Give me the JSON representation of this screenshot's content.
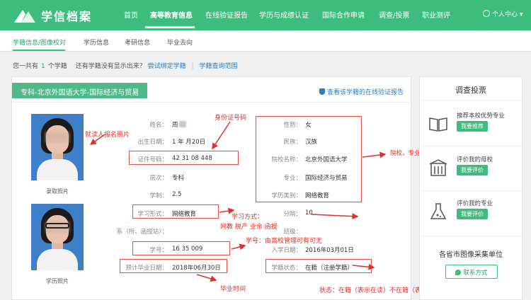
{
  "brand": {
    "name": "学信档案"
  },
  "nav": {
    "items": [
      "首页",
      "高等教育信息",
      "在线验证报告",
      "学历与成绩认证",
      "国际合作申请",
      "调查/投票",
      "职业测评"
    ],
    "user": "个人中心 ▾"
  },
  "subnav": {
    "items": [
      "学籍信息/图像校对",
      "学历信息",
      "考研信息",
      "毕业去向"
    ]
  },
  "summary": {
    "prefix": "您一共有",
    "count": "1",
    "suffix": "个学籍",
    "question": "还有学籍没有显示出来？",
    "bind_link": "尝试绑定学籍",
    "sep": "|",
    "scope_link": "学籍查询范围"
  },
  "card": {
    "title": "专科-北京外国语大学-国际经济与贸易",
    "verify_link": "查看该学籍的在线验证报告",
    "photo_captions": [
      "录取照片",
      "学历照片"
    ],
    "left_fields": [
      {
        "label": "姓名：",
        "value": "周"
      },
      {
        "label": "出生日期：",
        "value": "1 年 月20日"
      },
      {
        "label": "证件号码：",
        "value": "42 31 08 448"
      },
      {
        "label": "层次：",
        "value": "专科"
      },
      {
        "label": "学制：",
        "value": "2.5"
      },
      {
        "label": "学习形式：",
        "value": "网络教育"
      },
      {
        "label": "系（所、函授站）：",
        "value": ""
      },
      {
        "label": "学号：",
        "value": "16 35 009"
      },
      {
        "label": "预计毕业日期：",
        "value": "2018年06月30日"
      }
    ],
    "right_fields": [
      {
        "label": "性别：",
        "value": "女"
      },
      {
        "label": "民族：",
        "value": "汉族"
      },
      {
        "label": "院校名称：",
        "value": "北京外国语大学"
      },
      {
        "label": "专业：",
        "value": "国际经济与贸易"
      },
      {
        "label": "学历类别：",
        "value": "网络教育"
      },
      {
        "label": "分院：",
        "value": "10"
      },
      {
        "label": "班级：",
        "value": ""
      },
      {
        "label": "入学日期：",
        "value": "2016年03月01日"
      },
      {
        "label": "学籍状态：",
        "value": "在籍（注册学籍）"
      }
    ]
  },
  "annotations": {
    "photo": "就读人报名照片",
    "id": "身份证号码",
    "school": "院校，专业，学历性质",
    "study_form": "学习方式：",
    "study_form_2": "网教 脱产 业余 函授",
    "student_no": "学号：由高校管理可有可无",
    "grad": "毕业时间",
    "status": "状态：在籍（表示在读）不在籍（表示毕业）"
  },
  "sidebar": {
    "title": "调查投票",
    "items": [
      {
        "text": "推荐本校优势专业",
        "button": "我要推荐",
        "icon": "book-icon"
      },
      {
        "text": "评价我的母校",
        "button": "我要评价",
        "icon": "building-icon"
      },
      {
        "text": "评价我的专业",
        "button": "我要评价",
        "icon": "flask-icon"
      }
    ],
    "collect_title": "各省市图像采集单位",
    "contact_button": "联系方式"
  },
  "colors": {
    "brand": "#3dbd7d",
    "annotation": "#e0302a",
    "link": "#2a7fc1"
  }
}
